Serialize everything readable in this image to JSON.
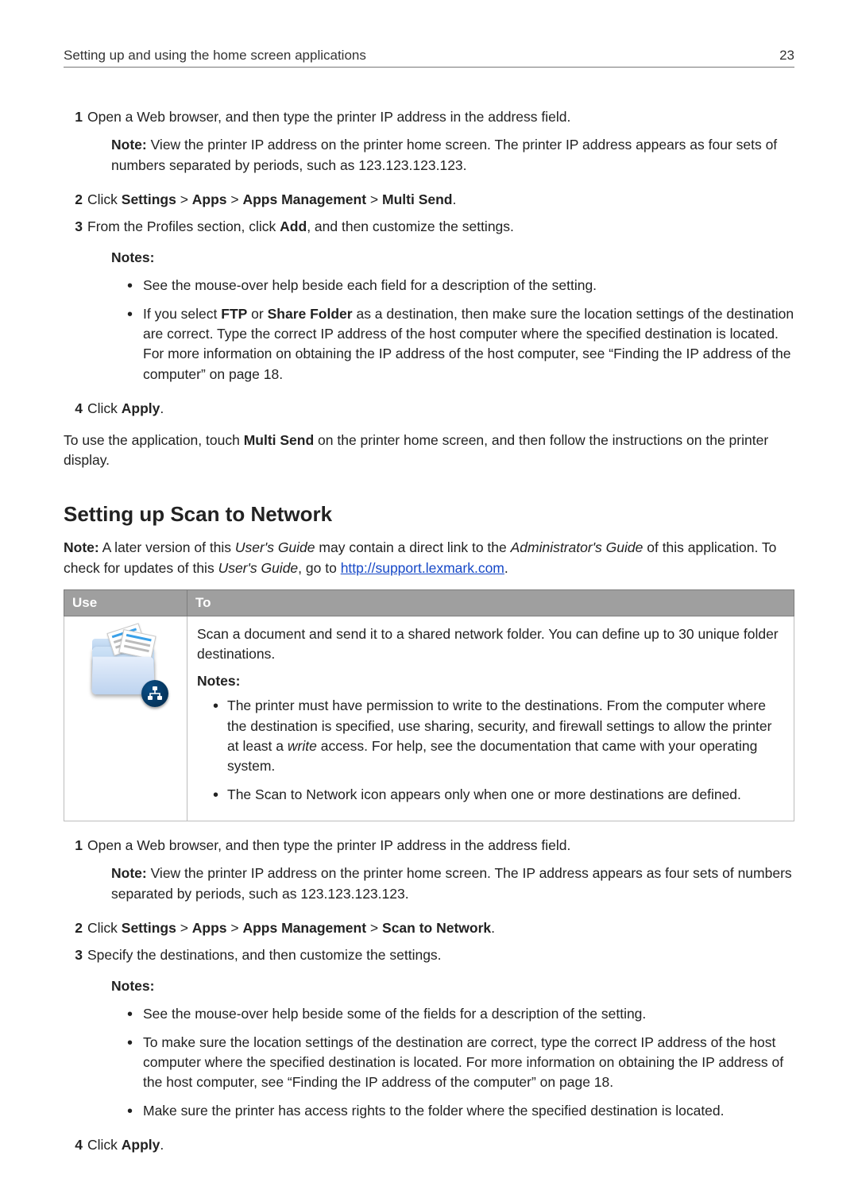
{
  "header": {
    "title": "Setting up and using the home screen applications",
    "page_number": "23"
  },
  "steps_a": {
    "s1": {
      "text": "Open a Web browser, and then type the printer IP address in the address field.",
      "note_label": "Note:",
      "note_body": " View the printer IP address on the printer home screen. The printer IP address appears as four sets of numbers separated by periods, such as 123.123.123.123."
    },
    "s2": {
      "prefix": " Click ",
      "p1": "Settings",
      "p2": "Apps",
      "p3": "Apps Management",
      "p4": "Multi Send",
      "gt": " > ",
      "period": "."
    },
    "s3": {
      "pre": "From the Profiles section, click ",
      "bold": "Add",
      "post": ", and then customize the settings.",
      "notes_label": "Notes:",
      "b1": "See the mouse‑over help beside each field for a description of the setting.",
      "b2_pre": "If you select ",
      "b2_ftp": "FTP",
      "b2_or": " or ",
      "b2_sf": "Share Folder",
      "b2_post": " as a destination, then make sure the location settings of the destination are correct. Type the correct IP address of the host computer where the specified destination is located. For more information on obtaining the IP address of the host computer, see “Finding the IP address of the computer” on page 18."
    },
    "s4": {
      "pre": " Click ",
      "bold": "Apply",
      "period": "."
    }
  },
  "closing_a": {
    "pre": "To use the application, touch ",
    "bold": "Multi Send",
    "post": " on the printer home screen, and then follow the instructions on the printer display."
  },
  "section_title": "Setting up Scan to Network",
  "intro_b": {
    "note_label": "Note:",
    "t1": " A later version of this ",
    "italic1": "User's Guide",
    "t2": " may contain a direct link to the ",
    "italic2": "Administrator's Guide",
    "t3": " of this application. To check for updates of this ",
    "italic3": "User's Guide",
    "t4": ", go to ",
    "link_text": "http://support.lexmark.com",
    "period": "."
  },
  "table": {
    "h_use": "Use",
    "h_to": "To",
    "desc": "Scan a document and send it to a shared network folder. You can define up to 30 unique folder destinations.",
    "notes_label": "Notes:",
    "n1_pre": "The printer must have permission to write to the destinations. From the computer where the destination is specified, use sharing, security, and firewall settings to allow the printer at least a ",
    "n1_italic": "write",
    "n1_post": " access. For help, see the documentation that came with your operating system.",
    "n2": "The Scan to Network icon appears only when one or more destinations are defined.",
    "icon_name": "scan-to-network-folder-icon"
  },
  "steps_b": {
    "s1": {
      "text": "Open a Web browser, and then type the printer IP address in the address field.",
      "note_label": "Note:",
      "note_body": " View the printer IP address on the printer home screen. The IP address appears as four sets of numbers separated by periods, such as 123.123.123.123."
    },
    "s2": {
      "prefix": " Click ",
      "p1": "Settings",
      "p2": "Apps",
      "p3": "Apps Management",
      "p4": "Scan to Network",
      "gt": " > ",
      "period": "."
    },
    "s3": {
      "text": "Specify the destinations, and then customize the settings.",
      "notes_label": "Notes:",
      "b1": "See the mouse-over help beside some of the fields for a description of the setting.",
      "b2": "To make sure the location settings of the destination are correct, type the correct IP address of the host computer where the specified destination is located. For more information on obtaining the IP address of the host computer, see “Finding the IP address of the computer” on page 18.",
      "b3": "Make sure the printer has access rights to the folder where the specified destination is located."
    },
    "s4": {
      "pre": " Click ",
      "bold": "Apply",
      "period": "."
    }
  }
}
